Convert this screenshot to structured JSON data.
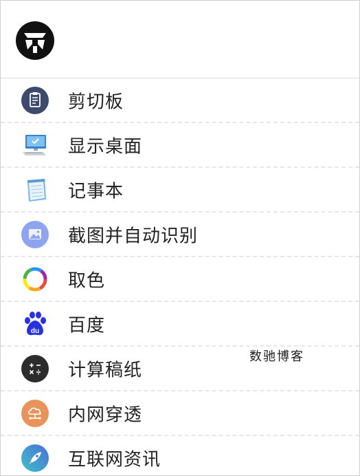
{
  "header": {
    "logo_icon": "app-logo-icon"
  },
  "menu": {
    "items": [
      {
        "label": "剪切板",
        "icon": "clipboard-icon"
      },
      {
        "label": "显示桌面",
        "icon": "desktop-computer-icon"
      },
      {
        "label": "记事本",
        "icon": "notepad-icon"
      },
      {
        "label": "截图并自动识别",
        "icon": "screenshot-image-icon"
      },
      {
        "label": "取色",
        "icon": "color-picker-ring-icon"
      },
      {
        "label": "百度",
        "icon": "baidu-paw-icon"
      },
      {
        "label": "计算稿纸",
        "icon": "calculator-icon"
      },
      {
        "label": "内网穿透",
        "icon": "cloud-network-icon"
      },
      {
        "label": "互联网资讯",
        "icon": "rocket-icon"
      }
    ]
  },
  "watermark": {
    "text": "数驰博客"
  }
}
